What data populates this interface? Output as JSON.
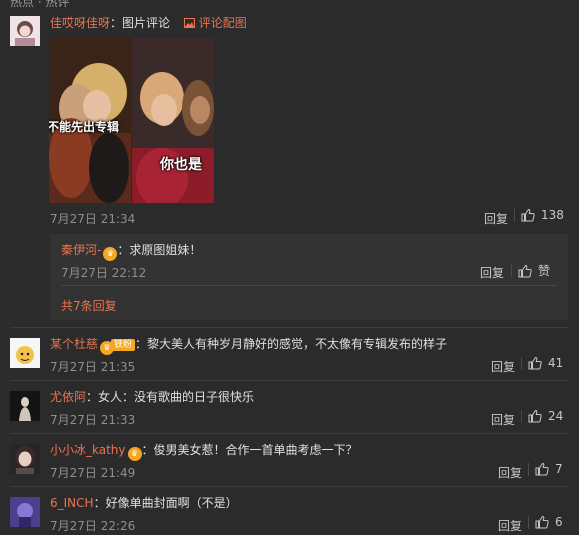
{
  "top_cut_text": "热点 · 热评",
  "comments": [
    {
      "user": "佳哎呀佳呀",
      "sep": "：",
      "text": "图片评论",
      "image_link": "评论配图",
      "image_caption_left": "不能先出专辑",
      "image_caption_right": "你也是",
      "time": "7月27日 21:34",
      "reply": "回复",
      "likes": "138",
      "nested": {
        "user": "秦伊河-",
        "text": "：求原图姐妹！",
        "time": "7月27日 22:12",
        "reply": "回复",
        "like_label": "赞",
        "more": "共7条回复"
      }
    },
    {
      "user": "某个杜慈",
      "badge_text": "铁粉",
      "text": "：黎大美人有种岁月静好的感觉，不太像有专辑发布的样子",
      "time": "7月27日 21:35",
      "reply": "回复",
      "likes": "41"
    },
    {
      "user": "尤依阿",
      "text": "：女人：没有歌曲的日子很快乐",
      "time": "7月27日 21:33",
      "reply": "回复",
      "likes": "24"
    },
    {
      "user": "小小冰_kathy",
      "text": "：俊男美女惹！合作一首单曲考虑一下？",
      "time": "7月27日 21:49",
      "reply": "回复",
      "likes": "7"
    },
    {
      "user": "6_INCH",
      "text": "：好像单曲封面啊（不是）",
      "time": "7月27日 22:26",
      "reply": "回复",
      "likes": "6"
    }
  ]
}
